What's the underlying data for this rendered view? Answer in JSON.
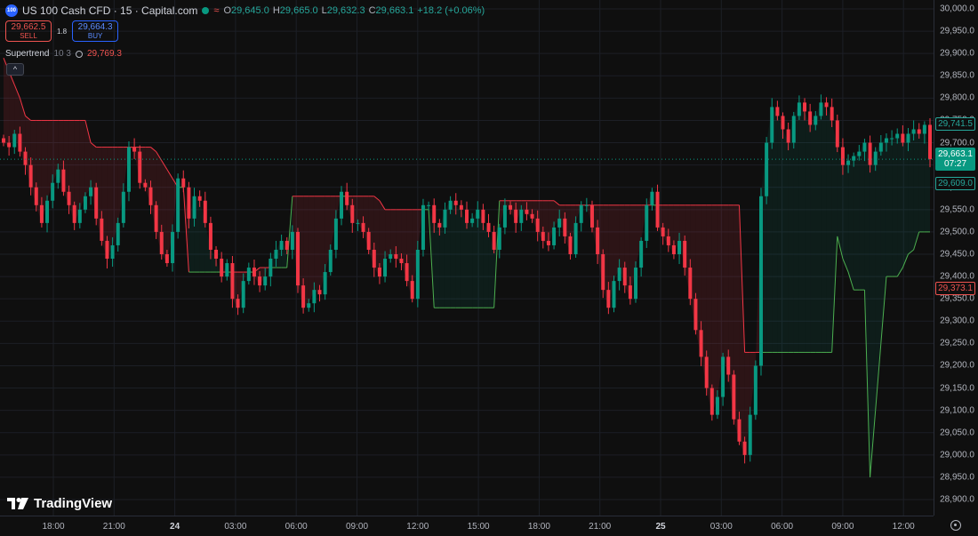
{
  "symbol": {
    "badge": "100",
    "title": "US 100 Cash CFD · 15 · Capital.com",
    "wave_icon": "≈",
    "ohlc": [
      {
        "key": "O",
        "value": "29,645.0"
      },
      {
        "key": "H",
        "value": "29,665.0"
      },
      {
        "key": "L",
        "value": "29,632.3"
      },
      {
        "key": "C",
        "value": "29,663.1"
      }
    ],
    "change": "+18.2 (+0.06%)"
  },
  "trade": {
    "sell_price": "29,662.5",
    "sell_label": "SELL",
    "spread": "1.8",
    "buy_price": "29,664.3",
    "buy_label": "BUY"
  },
  "indicator": {
    "name": "Supertrend",
    "params": "10 3",
    "value": "29,769.3"
  },
  "collapse_glyph": "^",
  "brand": "TradingView",
  "colors": {
    "up": "#089981",
    "down": "#f23645",
    "bg": "#0f0f0f"
  },
  "price_labels": {
    "upper": "29,741.5",
    "current": "29,663.1",
    "countdown": "07:27",
    "lower_green": "29,609.0",
    "lower_red": "29,373.1"
  },
  "chart_data": {
    "type": "candlestick",
    "ylim": [
      28900,
      30000
    ],
    "y_ticks": [
      "30,000.0",
      "29,950.0",
      "29,900.0",
      "29,850.0",
      "29,800.0",
      "29,750.0",
      "29,700.0",
      "29,650.0",
      "29,600.0",
      "29,550.0",
      "29,500.0",
      "29,450.0",
      "29,400.0",
      "29,350.0",
      "29,300.0",
      "29,250.0",
      "29,200.0",
      "29,150.0",
      "29,100.0",
      "29,050.0",
      "29,000.0",
      "28,950.0",
      "28,900.0"
    ],
    "x_ticks": [
      {
        "label": "18:00",
        "bold": false
      },
      {
        "label": "21:00",
        "bold": false
      },
      {
        "label": "24",
        "bold": true
      },
      {
        "label": "03:00",
        "bold": false
      },
      {
        "label": "06:00",
        "bold": false
      },
      {
        "label": "09:00",
        "bold": false
      },
      {
        "label": "12:00",
        "bold": false
      },
      {
        "label": "15:00",
        "bold": false
      },
      {
        "label": "18:00",
        "bold": false
      },
      {
        "label": "21:00",
        "bold": false
      },
      {
        "label": "25",
        "bold": true
      },
      {
        "label": "03:00",
        "bold": false
      },
      {
        "label": "06:00",
        "bold": false
      },
      {
        "label": "09:00",
        "bold": false
      },
      {
        "label": "12:00",
        "bold": false
      }
    ],
    "closes": [
      29700,
      29690,
      29720,
      29680,
      29650,
      29600,
      29560,
      29520,
      29570,
      29610,
      29640,
      29590,
      29560,
      29520,
      29550,
      29580,
      29600,
      29530,
      29480,
      29440,
      29470,
      29520,
      29590,
      29690,
      29680,
      29610,
      29600,
      29560,
      29500,
      29450,
      29430,
      29500,
      29620,
      29600,
      29530,
      29580,
      29570,
      29520,
      29460,
      29440,
      29400,
      29430,
      29350,
      29330,
      29390,
      29420,
      29400,
      29380,
      29400,
      29440,
      29460,
      29480,
      29460,
      29500,
      29380,
      29330,
      29340,
      29370,
      29360,
      29410,
      29460,
      29530,
      29590,
      29560,
      29520,
      29520,
      29500,
      29460,
      29420,
      29400,
      29440,
      29450,
      29440,
      29430,
      29390,
      29350,
      29460,
      29560,
      29560,
      29520,
      29510,
      29550,
      29570,
      29560,
      29550,
      29520,
      29530,
      29550,
      29520,
      29500,
      29460,
      29510,
      29560,
      29550,
      29520,
      29550,
      29540,
      29530,
      29500,
      29480,
      29470,
      29510,
      29530,
      29490,
      29450,
      29520,
      29560,
      29560,
      29510,
      29450,
      29370,
      29330,
      29390,
      29420,
      29380,
      29350,
      29420,
      29480,
      29560,
      29590,
      29510,
      29490,
      29470,
      29450,
      29480,
      29420,
      29350,
      29280,
      29220,
      29150,
      29090,
      29130,
      29220,
      29180,
      29080,
      29030,
      29000,
      29090,
      29200,
      29580,
      29700,
      29780,
      29760,
      29730,
      29700,
      29760,
      29790,
      29770,
      29740,
      29760,
      29790,
      29780,
      29750,
      29690,
      29650,
      29660,
      29670,
      29680,
      29700,
      29650,
      29680,
      29700,
      29710,
      29710,
      29720,
      29700,
      29720,
      29730,
      29720,
      29740,
      29663
    ],
    "supertrend": [
      29890,
      29860,
      29830,
      29800,
      29760,
      29750,
      29750,
      29750,
      29750,
      29750,
      29750,
      29750,
      29750,
      29750,
      29750,
      29750,
      29700,
      29690,
      29690,
      29690,
      29690,
      29690,
      29690,
      29690,
      29690,
      29690,
      29690,
      29690,
      29680,
      29660,
      29640,
      29620,
      29600,
      29600,
      29410,
      29410,
      29410,
      29410,
      29410,
      29410,
      29410,
      29410,
      29410,
      29410,
      29410,
      29410,
      29410,
      29420,
      29420,
      29420,
      29420,
      29420,
      29420,
      29580,
      29580,
      29580,
      29580,
      29580,
      29580,
      29580,
      29580,
      29580,
      29580,
      29580,
      29580,
      29580,
      29580,
      29580,
      29580,
      29570,
      29550,
      29550,
      29550,
      29550,
      29550,
      29550,
      29550,
      29550,
      29550,
      29330,
      29330,
      29330,
      29330,
      29330,
      29330,
      29330,
      29330,
      29330,
      29330,
      29330,
      29330,
      29570,
      29570,
      29570,
      29570,
      29570,
      29570,
      29570,
      29570,
      29570,
      29570,
      29570,
      29560,
      29560,
      29560,
      29560,
      29560,
      29560,
      29560,
      29560,
      29560,
      29560,
      29560,
      29560,
      29560,
      29560,
      29560,
      29560,
      29560,
      29560,
      29560,
      29560,
      29560,
      29560,
      29560,
      29560,
      29560,
      29560,
      29560,
      29560,
      29560,
      29560,
      29560,
      29560,
      29560,
      29560,
      29230,
      29230,
      29230,
      29230,
      29230,
      29230,
      29230,
      29230,
      29230,
      29230,
      29230,
      29230,
      29230,
      29230,
      29230,
      29230,
      29230,
      29490,
      29440,
      29410,
      29370,
      29370,
      29370,
      28950,
      29100,
      29250,
      29400,
      29400,
      29400,
      29420,
      29450,
      29460,
      29500,
      29500,
      29500,
      29520,
      29540,
      29580,
      29600,
      29600,
      29609
    ]
  }
}
